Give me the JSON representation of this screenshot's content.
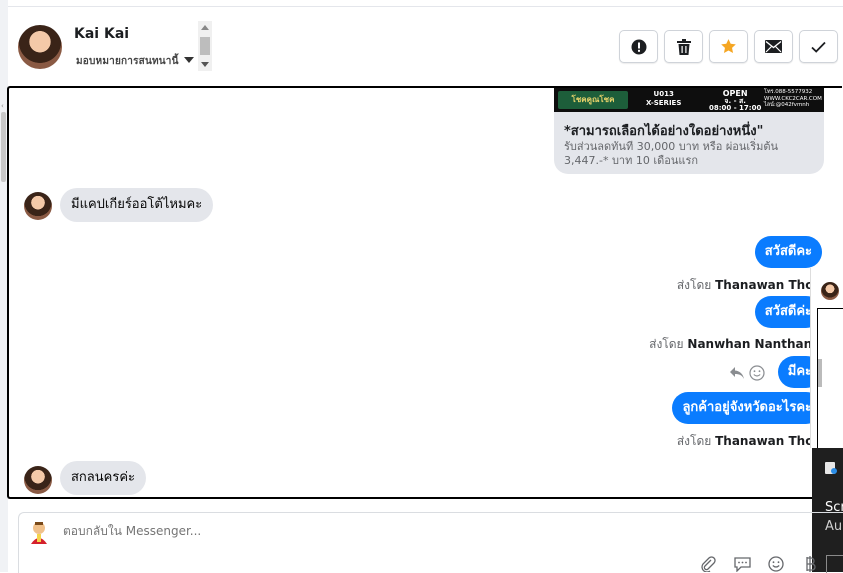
{
  "header": {
    "user_name": "Kai Kai",
    "assign_label": "มอบหมายการสนทนานี้"
  },
  "toolbar": {
    "actions": [
      {
        "name": "alert",
        "icon": "alert-circle-icon"
      },
      {
        "name": "delete",
        "icon": "trash-icon"
      },
      {
        "name": "star",
        "icon": "star-icon",
        "color": "#f5a623"
      },
      {
        "name": "email",
        "icon": "envelope-icon"
      },
      {
        "name": "done",
        "icon": "check-icon"
      }
    ]
  },
  "banner": {
    "logo_text": "โชคคูณโชค",
    "code": "U013",
    "series": "X-SERIES",
    "open": "OPEN",
    "days": "จ. - ส.",
    "hours": "08:00 - 17:00",
    "phone": "โทร.088-5577932",
    "site": "WWW.CKC2CAR.COM",
    "line": "ไลน์:@042fvmnh"
  },
  "card": {
    "title": "*สามารถเลือกได้อย่างใดอย่างหนึ่ง\"",
    "subtitle": "รับส่วนลดทันที 30,000 บาท หรือ ผ่อนเริ่มต้น 3,447.-* บาท 10 เดือนแรก"
  },
  "messages": {
    "in1": "มีแคปเกียร์ออโต้ไหมคะ",
    "out1": "สวัสดีคะ",
    "sent1_prefix": "ส่งโดย",
    "sent1_name": "Thanawan Thon",
    "out2": "สวัสดีค่ะ",
    "sent2_prefix": "ส่งโดย",
    "sent2_name": "Nanwhan Nanthanit",
    "out3": "มีคะ",
    "out4": "ลูกค้าอยู่จังหวัดอะไรคะ",
    "sent3_prefix": "ส่งโดย",
    "sent3_name": "Thanawan Thon",
    "in2": "สกลนครค่ะ"
  },
  "overlay": {
    "line1": "Scr",
    "line2": "Au"
  },
  "reply": {
    "placeholder": "ตอบกลับใน Messenger..."
  },
  "colors": {
    "accent": "#0a7cff",
    "incoming": "#e4e6eb",
    "star": "#f5a623"
  }
}
